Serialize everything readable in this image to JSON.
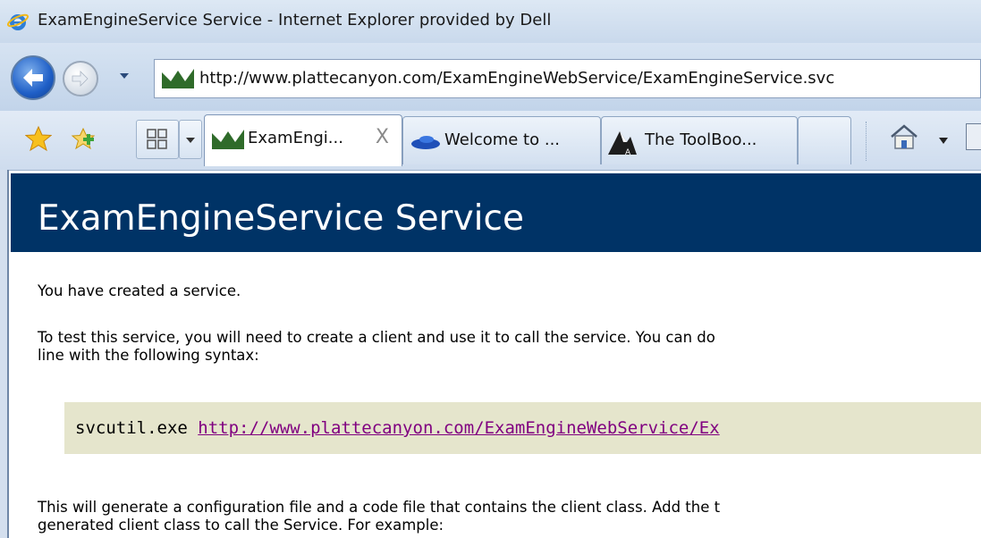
{
  "window": {
    "title": "ExamEngineService Service - Internet Explorer provided by Dell"
  },
  "nav": {
    "address": "http://www.plattecanyon.com/ExamEngineWebService/ExamEngineService.svc"
  },
  "tabs": [
    {
      "label": "ExamEngi...",
      "close": "X"
    },
    {
      "label": "Welcome to ..."
    },
    {
      "label": "The ToolBoo..."
    }
  ],
  "page": {
    "heading": "ExamEngineService Service",
    "para1": "You have created a service.",
    "para2_line1": "To test this service, you will need to create a client and use it to call the service. You can do",
    "para2_line2": "line with the following syntax:",
    "code_cmd": "svcutil.exe ",
    "code_url": "http://www.plattecanyon.com/ExamEngineWebService/Ex",
    "para3_line1": "This will generate a configuration file and a code file that contains the client class. Add the t",
    "para3_line2": "generated client class to call the Service. For example:"
  },
  "colors": {
    "banner": "#003366",
    "code_bg": "#e5e5cc",
    "link": "#800080"
  }
}
